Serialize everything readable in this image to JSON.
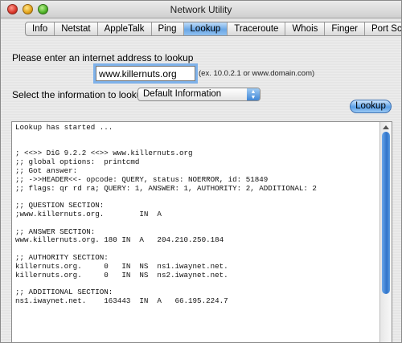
{
  "window": {
    "title": "Network Utility"
  },
  "tabs": [
    {
      "label": "Info",
      "active": false
    },
    {
      "label": "Netstat",
      "active": false
    },
    {
      "label": "AppleTalk",
      "active": false
    },
    {
      "label": "Ping",
      "active": false
    },
    {
      "label": "Lookup",
      "active": true
    },
    {
      "label": "Traceroute",
      "active": false
    },
    {
      "label": "Whois",
      "active": false
    },
    {
      "label": "Finger",
      "active": false
    },
    {
      "label": "Port Scan",
      "active": false
    }
  ],
  "lookup": {
    "address_prompt": "Please enter an internet address to lookup",
    "address_value": "www.killernuts.org",
    "address_hint": "(ex. 10.0.2.1 or www.domain.com)",
    "info_prompt": "Select the information to lookup:",
    "info_selected": "Default Information",
    "button_label": "Lookup"
  },
  "output": {
    "lines": [
      "Lookup has started ...",
      "",
      "",
      "; <<>> DiG 9.2.2 <<>> www.killernuts.org",
      ";; global options:  printcmd",
      ";; Got answer:",
      ";; ->>HEADER<<- opcode: QUERY, status: NOERROR, id: 51849",
      ";; flags: qr rd ra; QUERY: 1, ANSWER: 1, AUTHORITY: 2, ADDITIONAL: 2",
      "",
      ";; QUESTION SECTION:",
      ";www.killernuts.org.        IN  A",
      "",
      ";; ANSWER SECTION:",
      "www.killernuts.org. 180 IN  A   204.210.250.184",
      "",
      ";; AUTHORITY SECTION:",
      "killernuts.org.     0   IN  NS  ns1.iwaynet.net.",
      "killernuts.org.     0   IN  NS  ns2.iwaynet.net.",
      "",
      ";; ADDITIONAL SECTION:",
      "ns1.iwaynet.net.    163443  IN  A   66.195.224.7"
    ]
  }
}
